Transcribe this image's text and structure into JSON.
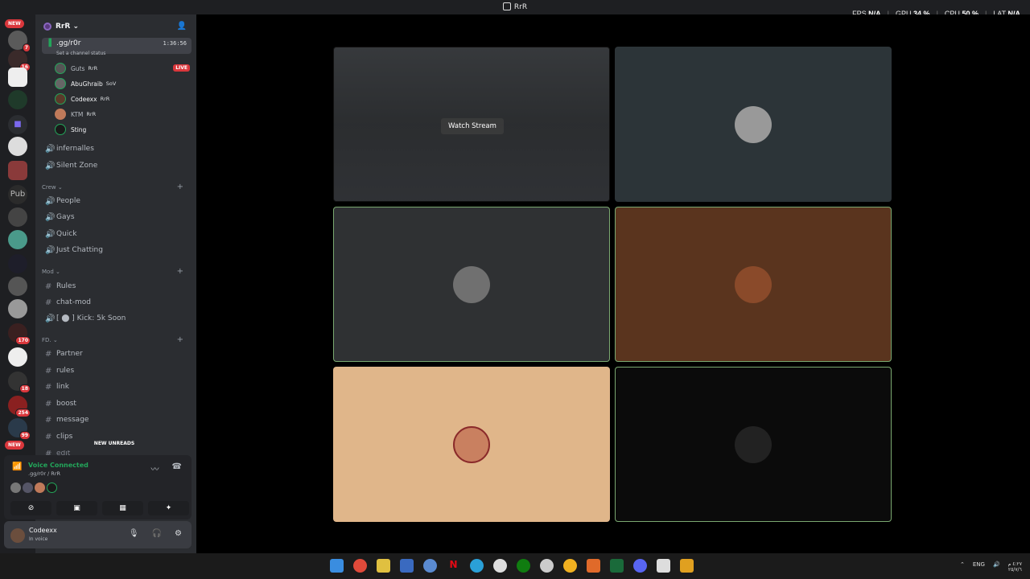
{
  "window": {
    "title": "RrR"
  },
  "overlay": {
    "fps_label": "FPS",
    "fps_value": "N/A",
    "gpu_label": "GPU",
    "gpu_value": "34 %",
    "cpu_label": "CPU",
    "cpu_value": "50 %",
    "lat_label": "LAT",
    "lat_value": "N/A"
  },
  "servers": {
    "new_top": "NEW",
    "new_bottom": "NEW",
    "badges": [
      "7",
      "16",
      "170",
      "18",
      "254",
      "99"
    ],
    "pub_label": "Pub"
  },
  "guild": {
    "name": "RrR"
  },
  "voice_channel": {
    "name": ".gg/r0r",
    "time": "1:36:56",
    "status": "Set a channel status"
  },
  "voice_users": [
    {
      "name": "Guts",
      "tag": "RrR",
      "live": "LIVE"
    },
    {
      "name": "AbuGhraib",
      "tag": "SoV"
    },
    {
      "name": "Codeexx",
      "tag": "RrR"
    },
    {
      "name": "KTM",
      "tag": "RrR"
    },
    {
      "name": "Sting",
      "tag": ""
    }
  ],
  "channels_top": [
    "infernalles",
    "Silent Zone"
  ],
  "categories": {
    "crew": {
      "label": "Crew",
      "channels": [
        "People",
        "Gays",
        "Quick",
        "Just Chatting"
      ]
    },
    "mod": {
      "label": "Mod",
      "channels": [
        "Rules",
        "chat-mod",
        "[ ⬤ ] Kick: 5k Soon"
      ]
    },
    "fd": {
      "label": "FD.",
      "channels": [
        "Partner",
        "rules",
        "link",
        "boost",
        "message",
        "clips",
        "edit"
      ]
    }
  },
  "new_unreads": "NEW UNREADS",
  "voice_panel": {
    "title": "Voice Connected",
    "sub": ".gg/r0r / RrR"
  },
  "user_panel": {
    "name": "Codeexx",
    "status": "In voice"
  },
  "stream": {
    "watch_label": "Watch Stream"
  },
  "tray": {
    "lang": "ENG",
    "time": "٤:٢٧ م",
    "date": "٢٥/٧/٦"
  }
}
